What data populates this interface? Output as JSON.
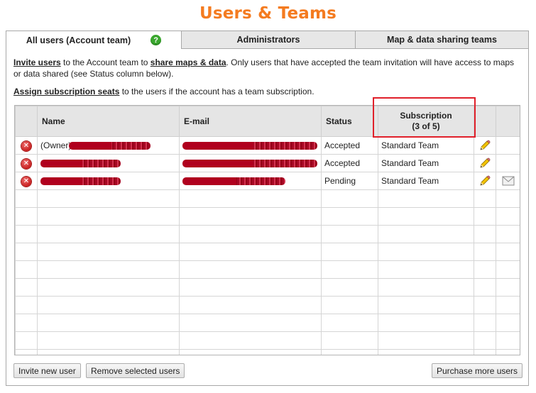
{
  "page": {
    "title": "Users & Teams"
  },
  "tabs": [
    {
      "label": "All users (Account team)",
      "help_icon": "?"
    },
    {
      "label": "Administrators"
    },
    {
      "label": "Map & data sharing teams"
    }
  ],
  "intro": {
    "invite_link": "Invite users",
    "text1": " to the Account team to ",
    "share_link": "share maps & data",
    "text2": ". Only users that have accepted the team invitation will have access to maps or data shared (see Status column below)."
  },
  "assign": {
    "link": "Assign subscription seats",
    "text": " to the users if the account has a team subscription."
  },
  "table": {
    "headers": {
      "name": "Name",
      "email": "E-mail",
      "status": "Status",
      "subscription": "Subscription",
      "subscription_count": "(3 of 5)"
    },
    "rows": [
      {
        "name_prefix": "(Owner)",
        "status": "Accepted",
        "subscription": "Standard Team",
        "has_mail": false
      },
      {
        "name_prefix": "",
        "status": "Accepted",
        "subscription": "Standard Team",
        "has_mail": false
      },
      {
        "name_prefix": "",
        "status": "Pending",
        "subscription": "Standard Team",
        "has_mail": true
      }
    ],
    "empty_rows": 10
  },
  "buttons": {
    "invite": "Invite new user",
    "remove": "Remove selected users",
    "purchase": "Purchase more users"
  },
  "icons": {
    "remove": "remove-circle-icon",
    "edit": "pencil-icon",
    "mail": "envelope-icon",
    "help": "help-circle-icon"
  },
  "colors": {
    "title": "#f47b20",
    "highlight": "#e0202a",
    "remove_icon": "#c81e1e",
    "help_icon": "#3aa72e"
  }
}
